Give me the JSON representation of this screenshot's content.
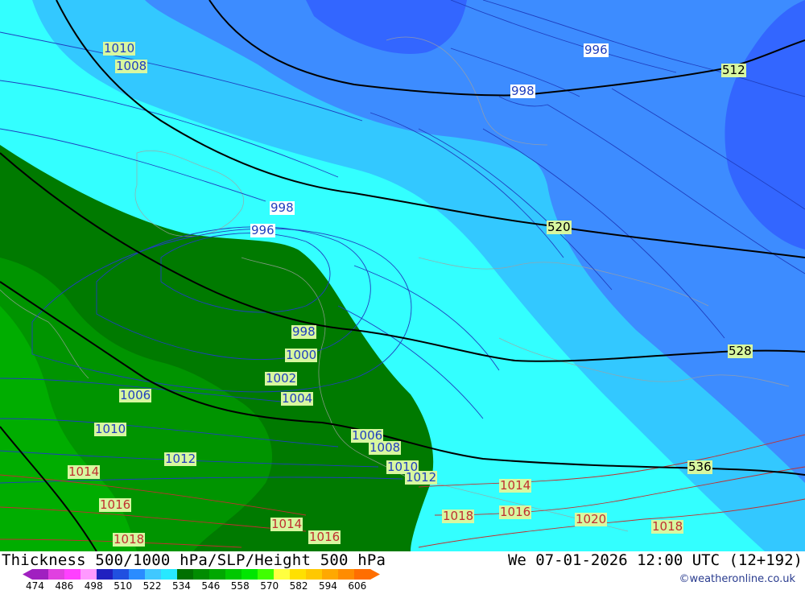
{
  "title": "Thickness 500/1000 hPa/SLP/Height 500 hPa",
  "datetime": "We 07-01-2026 12:00 UTC (12+192)",
  "credit": "©weatheronline.co.uk",
  "legend": {
    "ticks": [
      "474",
      "486",
      "498",
      "510",
      "522",
      "534",
      "546",
      "558",
      "570",
      "582",
      "594",
      "606"
    ],
    "colors": [
      "#a020c0",
      "#e040e0",
      "#ff40ff",
      "#ff99ff",
      "#2020c0",
      "#2050e0",
      "#2a8cff",
      "#40c8ff",
      "#28e8ff",
      "#007000",
      "#008c00",
      "#00a800",
      "#00c800",
      "#00e600",
      "#40ff00",
      "#ffff40",
      "#ffe000",
      "#ffc800",
      "#ffa800",
      "#ff8c00",
      "#ff6e00"
    ]
  },
  "map": {
    "height_labels": [
      "512",
      "520",
      "528",
      "536"
    ],
    "pressure_labels_blue": [
      "1010",
      "1008",
      "996",
      "998",
      "998",
      "996",
      "998",
      "1000",
      "1002",
      "1004",
      "1006",
      "1010",
      "1012",
      "1006",
      "1008",
      "1010",
      "1012"
    ],
    "pressure_labels_red": [
      "1014",
      "1016",
      "1018",
      "1014",
      "1016",
      "1014",
      "1018",
      "1016",
      "1020",
      "1018"
    ],
    "colors": {
      "thickness_blue_dark": "#3366ff",
      "thickness_blue": "#3d8cff",
      "thickness_blue_light": "#33c8ff",
      "thickness_cyan": "#33ffff",
      "thickness_green_dark": "#007a00",
      "thickness_green": "#009400",
      "thickness_green_light": "#00ad00",
      "height_contour": "#000000",
      "isobar_low": "#1f3fbf",
      "isobar_high": "#c03030",
      "label_bg_green": "#d8f7a0",
      "label_bg_white": "#ffffff"
    }
  }
}
